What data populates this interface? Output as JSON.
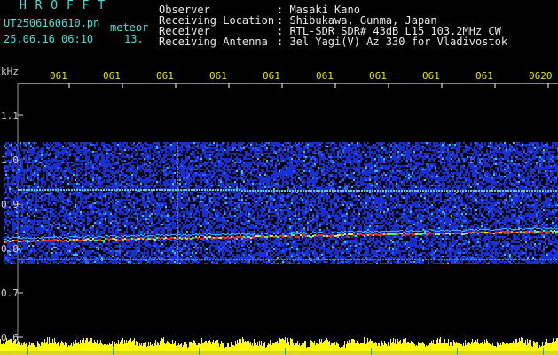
{
  "title": "H R O F F T",
  "file_name": "UT2506160610.pn",
  "file_suffix": "meteor",
  "date_time": "25.06.16 06:10",
  "count": "13.",
  "info": {
    "observer_label": "Observer",
    "observer_value": ": Masaki Kano",
    "location_label": "Receiving Location",
    "location_value": ": Shibukawa, Gunma, Japan",
    "receiver_label": "Receiver",
    "receiver_value": ": RTL-SDR SDR# 43dB L15 103.2MHz CW",
    "antenna_label": "Receiving Antenna",
    "antenna_value": ": 3el Yagi(V) Az 330 for Vladivostok"
  },
  "axis": {
    "unit": "kHz",
    "y_ticks": [
      "1.1",
      "1.0",
      "0.9",
      "0.8",
      "0.7",
      "0.6"
    ],
    "x_ticks": [
      "061",
      "061",
      "061",
      "061",
      "061",
      "061",
      "061",
      "061",
      "061",
      "0620"
    ]
  },
  "colors": {
    "background": "#000000",
    "noise": "#1a2fd0",
    "trace_red": "#ff2a2a",
    "trace_green": "#3cff6a",
    "amplitude": "#ffff00"
  }
}
